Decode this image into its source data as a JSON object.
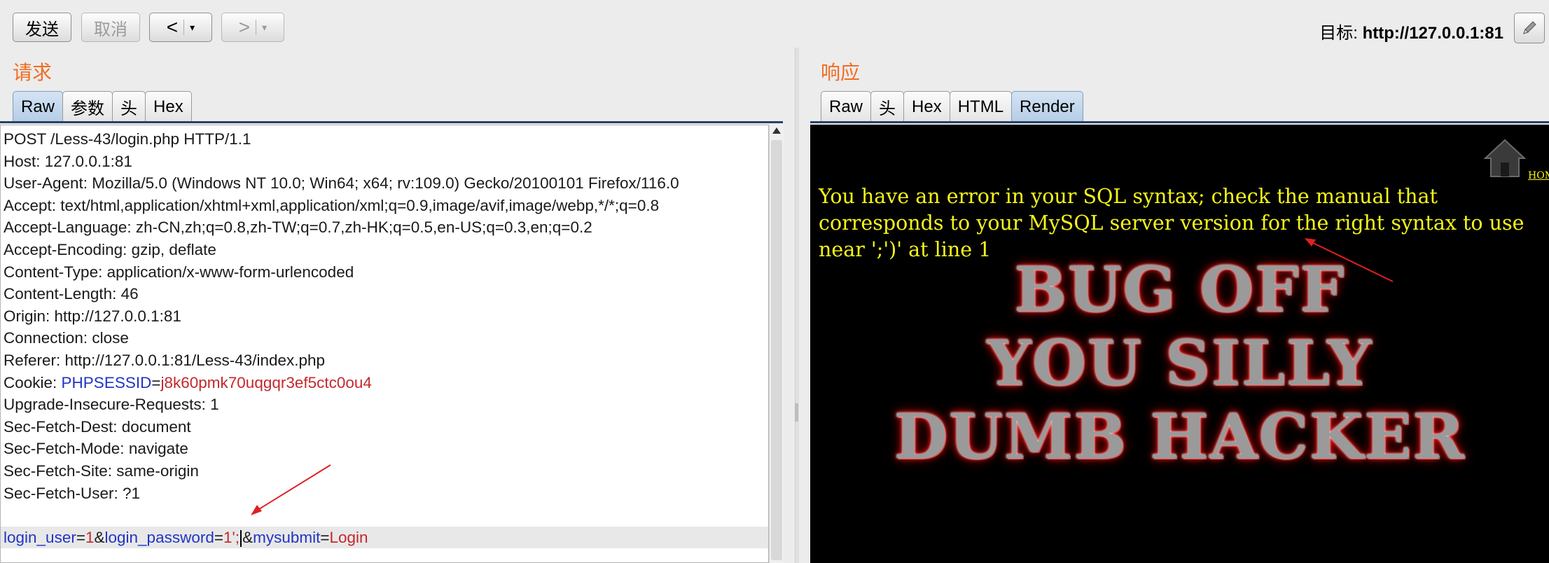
{
  "toolbar": {
    "send": "发送",
    "cancel": "取消",
    "back": "<",
    "forward": ">",
    "dropdown": "▾",
    "target_prefix": "目标: ",
    "target_url": "http://127.0.0.1:81"
  },
  "request": {
    "title": "请求",
    "tabs": [
      "Raw",
      "参数",
      "头",
      "Hex"
    ],
    "active_tab": "Raw",
    "lines": [
      "POST /Less-43/login.php HTTP/1.1",
      "Host: 127.0.0.1:81",
      "User-Agent: Mozilla/5.0 (Windows NT 10.0; Win64; x64; rv:109.0) Gecko/20100101 Firefox/116.0",
      "Accept: text/html,application/xhtml+xml,application/xml;q=0.9,image/avif,image/webp,*/*;q=0.8",
      "Accept-Language: zh-CN,zh;q=0.8,zh-TW;q=0.7,zh-HK;q=0.5,en-US;q=0.3,en;q=0.2",
      "Accept-Encoding: gzip, deflate",
      "Content-Type: application/x-www-form-urlencoded",
      "Content-Length: 46",
      "Origin: http://127.0.0.1:81",
      "Connection: close",
      "Referer: http://127.0.0.1:81/Less-43/index.php"
    ],
    "cookie": {
      "prefix": "Cookie: ",
      "name": "PHPSESSID",
      "eq": "=",
      "value": "j8k60pmk70uqgqr3ef5ctc0ou4"
    },
    "lines_after": [
      "Upgrade-Insecure-Requests: 1",
      "Sec-Fetch-Dest: document",
      "Sec-Fetch-Mode: navigate",
      "Sec-Fetch-Site: same-origin",
      "Sec-Fetch-User: ?1"
    ],
    "body": {
      "k1": "login_user",
      "eq": "=",
      "v1": "1",
      "amp1": "&",
      "k2": "login_password",
      "v2": "1';",
      "amp2": "&",
      "k3": "mysubmit",
      "v3": "Login"
    }
  },
  "response": {
    "title": "响应",
    "tabs": [
      "Raw",
      "头",
      "Hex",
      "HTML",
      "Render"
    ],
    "active_tab": "Render",
    "home_link": "HOME",
    "error_message": "You have an error in your SQL syntax; check the manual that corresponds to your MySQL server version for the right syntax to use near ';')' at line 1",
    "banner_lines": [
      "BUG OFF",
      "YOU SILLY",
      "DUMB HACKER"
    ]
  },
  "colors": {
    "section_title": "#f26d22",
    "param_key": "#2135c4",
    "param_value": "#c4282c",
    "error_text": "#f5f51a",
    "annotation_arrow": "#e02020"
  }
}
